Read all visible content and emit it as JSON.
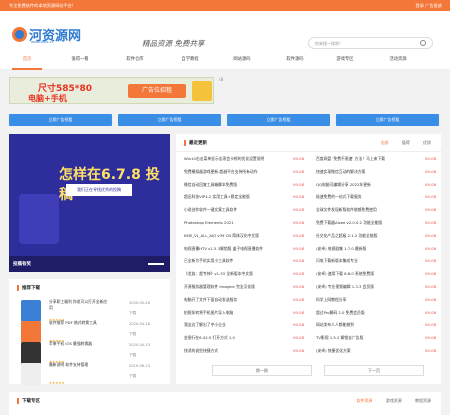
{
  "topbar": {
    "left": "专注免费软件的本地资源网站平台!",
    "right": "登录  广告投放"
  },
  "header": {
    "logo": "河资源网",
    "logo_sub": "www.xzbk.cc",
    "slogan": "精品资源 免费共享",
    "search_placeholder": "你来搜一搜吧！"
  },
  "nav": [
    "首页",
    "值得一看",
    "软件仓库",
    "自学教程",
    "网站源码",
    "软件源码",
    "游戏专区",
    "活动资源"
  ],
  "banner": {
    "line1": "尺寸585*80",
    "line2": "电脑+手机",
    "cta": "广告位招租",
    "alt": "r8"
  },
  "ad_buttons": [
    "立即广告招租",
    "立即广告招租",
    "立即广告招租",
    "立即广告招租"
  ],
  "slider": {
    "headline": "怎样在6.7.8 投稿",
    "sub": "我们正在寻找优秀的投稿",
    "caption": "投稿有奖"
  },
  "latest": {
    "title": "最近更新",
    "tabs": [
      "全部",
      "值得",
      "优质"
    ],
    "left": [
      {
        "t": "Win10右击菜单显示出项会卡顿的优化设置说明",
        "d": "09-08"
      },
      {
        "t": "免费模拟器游戏更新-超越平台支持所有动作",
        "d": "09-08"
      },
      {
        "t": "微信自动回复工具箱脚本免费版",
        "d": "09-08"
      },
      {
        "t": "超迅科技VIP4.2 实用工具+稳定全能版",
        "d": "09-08"
      },
      {
        "t": "小说创作软件一键文案工具软件",
        "d": "09-08"
      },
      {
        "t": "Photoshop Elements 2021",
        "d": "09-08"
      },
      {
        "t": "KMS_VL_ALL_AIO v39 CN 简体汉化中文版",
        "d": "09-08"
      },
      {
        "t": "电视直播HTV v1.5.3解锁版 盒子电视直播软件",
        "d": "09-08"
      },
      {
        "t": "已全新为手机实用小工具软件",
        "d": "09-08"
      },
      {
        "t": "《龙族：超专神》v1.33 全新版本中文版",
        "d": "09-08"
      },
      {
        "t": "开源服务器管理软件 Imagine 完全汉化版",
        "d": "09-08"
      },
      {
        "t": "电脑开了文件下面自动发送服务",
        "d": "09-08"
      },
      {
        "t": "拍照如何将手机图片导入电脑",
        "d": "09-08"
      },
      {
        "t": "我这边了解出了中小企业",
        "d": "09-08"
      },
      {
        "t": "金银行在6.42.0 打开方式 1.0",
        "d": "09-08"
      },
      {
        "t": "快消的说些快捷方式",
        "d": "09-08"
      }
    ],
    "right": [
      {
        "t": "百度网盘 '免费不限速' 方法！马上来下载",
        "d": "09-08"
      },
      {
        "t": "快速实现微信互动的解决方案",
        "d": "09-08"
      },
      {
        "t": "QQ电脑可编辑分享 2022年更新",
        "d": "09-08"
      },
      {
        "t": "极速免费的一站式下载服务",
        "d": "09-08"
      },
      {
        "t": "全球文件发现新版软件能够免费使用",
        "d": "09-08"
      },
      {
        "t": "免费下载器Aisee v2.0.0.2 功能全能版",
        "d": "09-08"
      },
      {
        "t": "社交化产品之超级 2.1.2 功能全能版",
        "d": "09-08"
      },
      {
        "t": "(安卓) 电视剧集 1.7.0 最新版",
        "d": "09-08"
      },
      {
        "t": "闪电下载新版本集成专业",
        "d": "09-08"
      },
      {
        "t": "(安卓) 速用下载 6.8.0 系统免费版",
        "d": "09-08"
      },
      {
        "t": "(安卓) 专业视频编辑 1.3.3 会员版",
        "d": "09-08"
      },
      {
        "t": "科学上网教程分享",
        "d": "09-08"
      },
      {
        "t": "超过Pro解码 2.0 免费会员版",
        "d": "09-08"
      },
      {
        "t": "网站发布人人都能做到",
        "d": "09-08"
      },
      {
        "t": "TV影视 1.5.2 解锁去广告版",
        "d": "09-08"
      },
      {
        "t": "(安卓) 快捷优化方案",
        "d": "09-08"
      }
    ],
    "more": [
      "换一换",
      "下一页"
    ]
  },
  "recommend": {
    "title": "推荐下载",
    "items": [
      {
        "t": "分享职工福利 你说可以打开全新应用",
        "date": "2020-05-26",
        "sub": "下载"
      },
      {
        "t": "软件推荐 PDF 格式转换工具",
        "date": "2020-04-18",
        "sub": "下载"
      },
      {
        "t": "苹果手机 iOS 最强转换器",
        "date": "2020-04-13",
        "sub": "下载"
      },
      {
        "t": "最新说明 软件支持管理",
        "date": "2019-08-13",
        "sub": "下载"
      }
    ],
    "stars": "★★★★★"
  },
  "bottom": {
    "title": "下载专区",
    "tabs": [
      "软件资源",
      "游戏资源",
      "教程资源"
    ]
  }
}
